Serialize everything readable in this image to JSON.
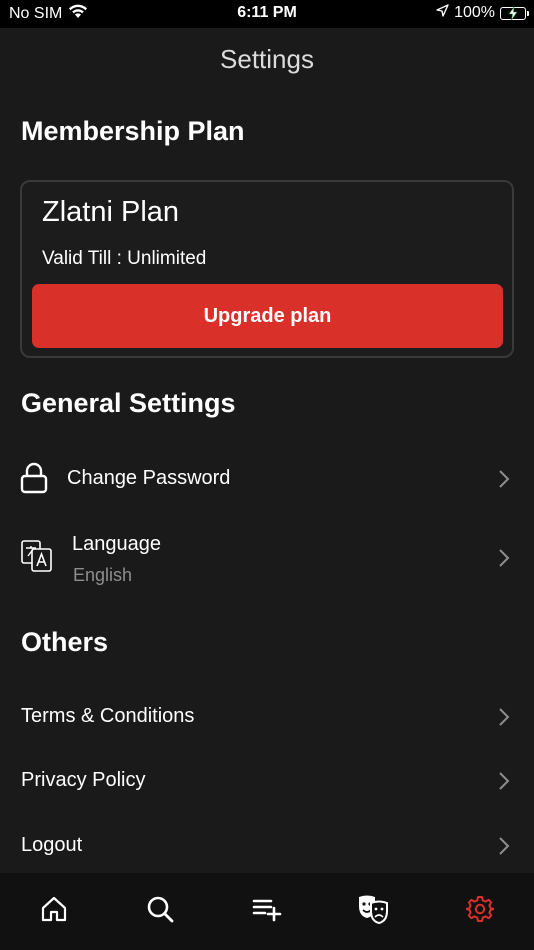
{
  "status_bar": {
    "carrier": "No SIM",
    "time": "6:11 PM",
    "battery": "100%",
    "icons": [
      "wifi-icon",
      "location-arrow-icon",
      "battery-charging-icon"
    ]
  },
  "header": {
    "title": "Settings"
  },
  "membership": {
    "section_title": "Membership Plan",
    "plan_name": "Zlatni Plan",
    "valid_till": "Valid Till : Unlimited",
    "upgrade_label": "Upgrade plan",
    "upgrade_color": "#d9302a"
  },
  "general": {
    "section_title": "General Settings",
    "items": [
      {
        "label": "Change Password",
        "icon": "lock-icon"
      },
      {
        "label": "Language",
        "sub": "English",
        "icon": "translate-icon"
      }
    ]
  },
  "others": {
    "section_title": "Others",
    "items": [
      {
        "label": "Terms & Conditions"
      },
      {
        "label": "Privacy Policy"
      },
      {
        "label": "Logout"
      }
    ]
  },
  "tab_bar": {
    "tabs": [
      {
        "name": "home",
        "icon": "home-icon",
        "active": false
      },
      {
        "name": "search",
        "icon": "search-icon",
        "active": false
      },
      {
        "name": "playlist",
        "icon": "playlist-add-icon",
        "active": false
      },
      {
        "name": "genres",
        "icon": "theater-masks-icon",
        "active": false
      },
      {
        "name": "settings",
        "icon": "gear-icon",
        "active": true
      }
    ],
    "active_color": "#d9302a",
    "inactive_color": "#ffffff"
  }
}
